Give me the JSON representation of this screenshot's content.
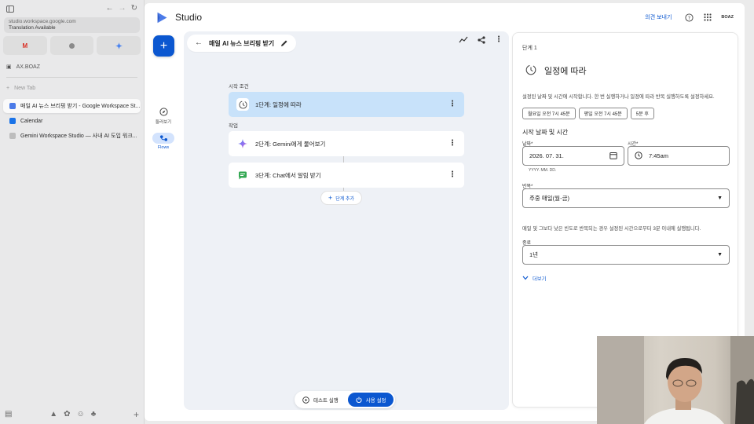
{
  "browser": {
    "url": "studio.workspace.google.com",
    "translation": "Translation Available",
    "space_name": "AX.BOAZ",
    "new_tab": "New Tab",
    "tabs": [
      {
        "title": "매일 AI 뉴스 브리핑 받기 - Google Workspace St...",
        "active": true,
        "favicon": "studio-icon",
        "color": "#4c7be8"
      },
      {
        "title": "Calendar",
        "active": false,
        "favicon": "calendar-icon",
        "color": "#1a73e8"
      },
      {
        "title": "Gemini Workspace Studio — 사내 AI 도입 워크...",
        "active": false,
        "favicon": "doc-icon",
        "color": "#bdbdbd"
      }
    ]
  },
  "app": {
    "title": "Studio",
    "feedback": "의견 보내기",
    "account": "BOAZ"
  },
  "rail": {
    "explore": "둘러보기",
    "flows": "Flows"
  },
  "flow": {
    "title": "매일 AI 뉴스 브리핑 받기",
    "trigger_label": "시작 조건",
    "actions_label": "작업",
    "steps": [
      {
        "label": "1단계: 일정에 따라",
        "icon": "clock-icon"
      },
      {
        "label": "2단계: Gemini에게 물어보기",
        "icon": "gemini-icon"
      },
      {
        "label": "3단계: Chat에서 알림 받기",
        "icon": "chat-icon"
      }
    ],
    "add_step": "단계 추가",
    "test_run": "테스트 실행",
    "enable": "사용 설정"
  },
  "panel": {
    "step_label": "단계 1",
    "title": "일정에 따라",
    "description": "설정된 날짜 및 시간에 시작합니다. 한 번 실행하거나 일정에 따라 반복 실행하도록 설정하세요.",
    "chips": [
      "월요일 오전 7시 45분",
      "평일 오전 7시 45분",
      "5분 후"
    ],
    "start_section": "시작 날짜 및 시간",
    "date_label": "날짜*",
    "date_value": "2026. 07. 31.",
    "date_hint": "YYYY. MM. DD.",
    "time_label": "시간*",
    "time_value": "7:45am",
    "repeat_label": "반복*",
    "repeat_value": "주중 매일(월-금)",
    "note": "매일 및 그보다 낮은 빈도로 반복되는 경우 설정된 시간으로부터 3분 이내에 실행됩니다.",
    "end_label": "종료",
    "end_value": "1년",
    "more": "더보기"
  }
}
